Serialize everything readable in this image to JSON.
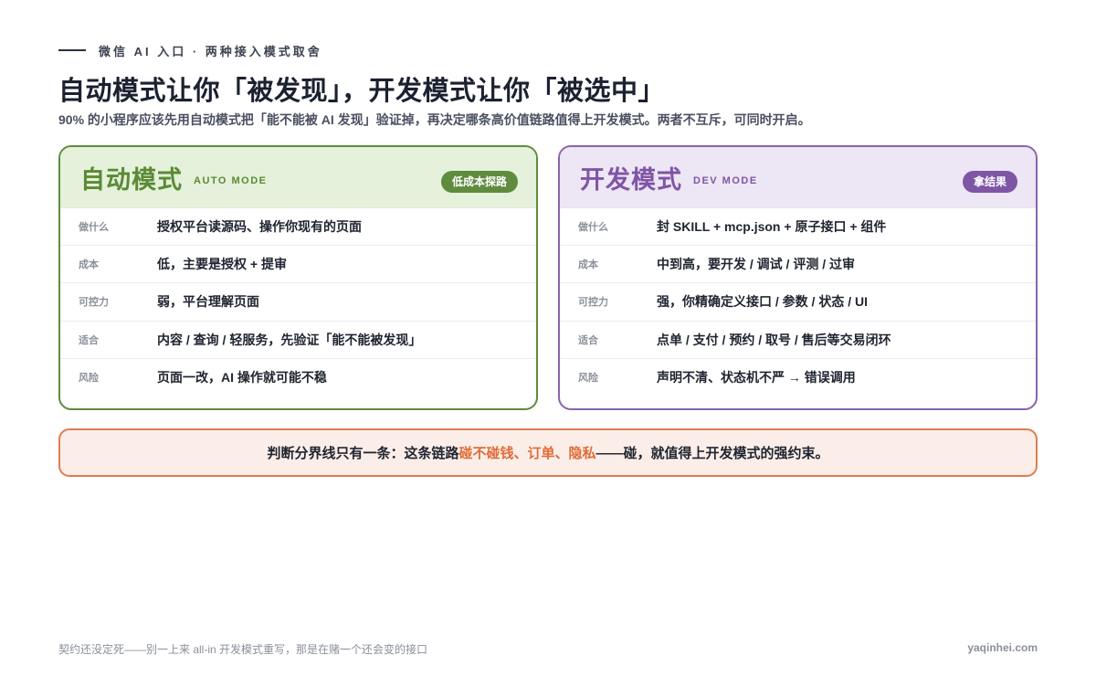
{
  "kicker": "微信 AI 入口 · 两种接入模式取舍",
  "title": "自动模式让你「被发现」，开发模式让你「被选中」",
  "subtitle": "90% 的小程序应该先用自动模式把「能不能被 AI 发现」验证掉，再决定哪条高价值链路值得上开发模式。两者不互斥，可同时开启。",
  "auto_card": {
    "title": "自动模式",
    "subtitle": "AUTO MODE",
    "badge": "低成本探路",
    "rows": [
      {
        "label": "做什么",
        "value": "授权平台读源码、操作你现有的页面"
      },
      {
        "label": "成本",
        "value": "低，主要是授权 + 提审"
      },
      {
        "label": "可控力",
        "value": "弱，平台理解页面"
      },
      {
        "label": "适合",
        "value": "内容 / 查询 / 轻服务，先验证「能不能被发现」"
      },
      {
        "label": "风险",
        "value": "页面一改，AI 操作就可能不稳"
      }
    ]
  },
  "dev_card": {
    "title": "开发模式",
    "subtitle": "DEV MODE",
    "badge": "拿结果",
    "rows": [
      {
        "label": "做什么",
        "value": "封 SKILL + mcp.json + 原子接口 + 组件"
      },
      {
        "label": "成本",
        "value": "中到高，要开发 / 调试 / 评测 / 过审"
      },
      {
        "label": "可控力",
        "value": "强，你精确定义接口 / 参数 / 状态 / UI"
      },
      {
        "label": "适合",
        "value": "点单 / 支付 / 预约 / 取号 / 售后等交易闭环"
      },
      {
        "label": "风险",
        "value": "声明不清、状态机不严 → 错误调用"
      }
    ]
  },
  "verdict": {
    "prefix": "判断分界线只有一条：这条链路",
    "highlight": "碰不碰钱、订单、隐私",
    "suffix": "——碰，就值得上开发模式的强约束。"
  },
  "footer": {
    "left": "契约还没定死——别一上来 all-in 开发模式重写，那是在赌一个还会变的接口",
    "right": "yaqinhei.com"
  },
  "colors": {
    "auto_accent": "#5f8b3e",
    "dev_accent": "#7f55a6",
    "verdict_accent": "#e06b37"
  }
}
